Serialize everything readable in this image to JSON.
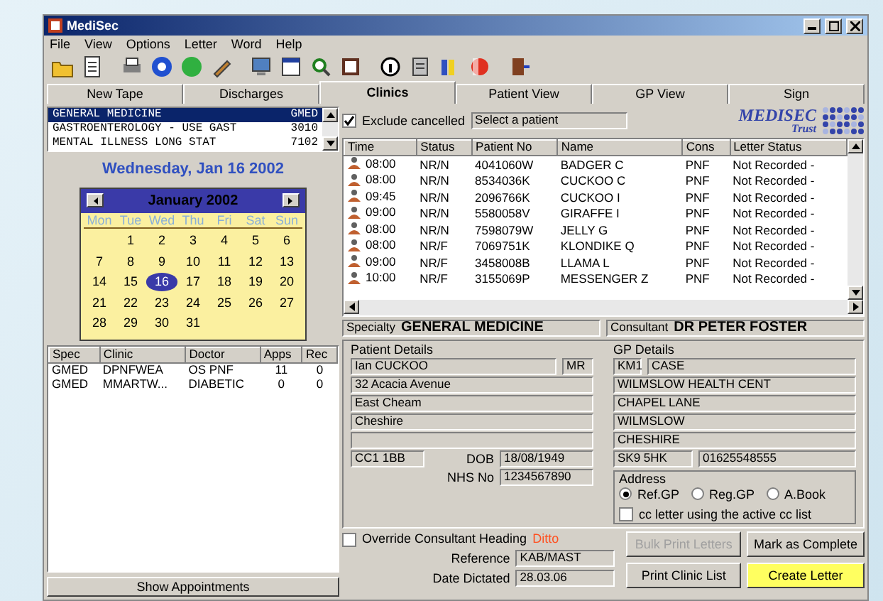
{
  "window": {
    "title": "MediSec"
  },
  "menu": [
    "File",
    "View",
    "Options",
    "Letter",
    "Word",
    "Help"
  ],
  "tabs": [
    {
      "label": "New Tape",
      "selected": false
    },
    {
      "label": "Discharges",
      "selected": false
    },
    {
      "label": "Clinics",
      "selected": true
    },
    {
      "label": "Patient View",
      "selected": false
    },
    {
      "label": "GP View",
      "selected": false
    },
    {
      "label": "Sign",
      "selected": false
    }
  ],
  "specialties": [
    {
      "name": "GENERAL MEDICINE",
      "code": "GMED",
      "selected": true
    },
    {
      "name": "GASTROENTEROLOGY - USE GAST",
      "code": "3010",
      "selected": false
    },
    {
      "name": "MENTAL ILLNESS LONG STAT",
      "code": "7102",
      "selected": false
    }
  ],
  "date_header": "Wednesday, Jan 16 2002",
  "calendar": {
    "month": "January 2002",
    "weekdays": [
      "Mon",
      "Tue",
      "Wed",
      "Thu",
      "Fri",
      "Sat",
      "Sun"
    ],
    "weeks": [
      [
        {
          "day": "1",
          "selected": false
        },
        {
          "day": "2",
          "selected": false
        },
        {
          "day": "3",
          "selected": false
        },
        {
          "day": "4",
          "selected": false
        },
        {
          "day": "5",
          "selected": false
        },
        {
          "day": "6",
          "selected": false
        }
      ],
      [
        {
          "day": "7",
          "selected": false
        },
        {
          "day": "8",
          "selected": false
        },
        {
          "day": "9",
          "selected": false
        },
        {
          "day": "10",
          "selected": false
        },
        {
          "day": "11",
          "selected": false
        },
        {
          "day": "12",
          "selected": false
        },
        {
          "day": "13",
          "selected": false
        }
      ],
      [
        {
          "day": "14",
          "selected": false
        },
        {
          "day": "15",
          "selected": false
        },
        {
          "day": "16",
          "selected": true
        },
        {
          "day": "17",
          "selected": false
        },
        {
          "day": "18",
          "selected": false
        },
        {
          "day": "19",
          "selected": false
        },
        {
          "day": "20",
          "selected": false
        }
      ],
      [
        {
          "day": "21",
          "selected": false
        },
        {
          "day": "22",
          "selected": false
        },
        {
          "day": "23",
          "selected": false
        },
        {
          "day": "24",
          "selected": false
        },
        {
          "day": "25",
          "selected": false
        },
        {
          "day": "26",
          "selected": false
        },
        {
          "day": "27",
          "selected": false
        }
      ],
      [
        {
          "day": "28",
          "selected": false
        },
        {
          "day": "29",
          "selected": false
        },
        {
          "day": "30",
          "selected": false
        },
        {
          "day": "31",
          "selected": false
        }
      ]
    ]
  },
  "clinics": {
    "columns": [
      "Spec",
      "Clinic",
      "Doctor",
      "Apps",
      "Rec"
    ],
    "rows": [
      [
        "GMED",
        "DPNFWEA",
        "OS PNF",
        "11",
        "0"
      ],
      [
        "GMED",
        "MMARTW...",
        "DIABETIC",
        "0",
        "0"
      ]
    ]
  },
  "show_appointments": "Show Appointments",
  "exclude_cancelled": {
    "label": "Exclude cancelled",
    "checked": true
  },
  "patient_select": {
    "value": "Select a patient"
  },
  "logo": {
    "name": "MEDISEC",
    "subtitle": "Trust"
  },
  "appointments": {
    "columns": [
      "Time",
      "Status",
      "Patient No",
      "Name",
      "Cons",
      "Letter Status"
    ],
    "rows": [
      [
        "08:00",
        "NR/N",
        "4041060W",
        "BADGER C",
        "PNF",
        "Not Recorded -"
      ],
      [
        "08:00",
        "NR/N",
        "8534036K",
        "CUCKOO C",
        "PNF",
        "Not Recorded -"
      ],
      [
        "09:45",
        "NR/N",
        "2096766K",
        "CUCKOO I",
        "PNF",
        "Not Recorded -"
      ],
      [
        "09:00",
        "NR/N",
        "5580058V",
        "GIRAFFE I",
        "PNF",
        "Not Recorded -"
      ],
      [
        "08:00",
        "NR/N",
        "7598079W",
        "JELLY G",
        "PNF",
        "Not Recorded -"
      ],
      [
        "08:00",
        "NR/F",
        "7069751K",
        "KLONDIKE Q",
        "PNF",
        "Not Recorded -"
      ],
      [
        "09:00",
        "NR/F",
        "3458008B",
        "LLAMA L",
        "PNF",
        "Not Recorded -"
      ],
      [
        "10:00",
        "NR/F",
        "3155069P",
        "MESSENGER Z",
        "PNF",
        "Not Recorded -"
      ]
    ]
  },
  "specialty": {
    "label": "Specialty",
    "value": "GENERAL MEDICINE"
  },
  "consultant": {
    "label": "Consultant",
    "value": "DR PETER FOSTER"
  },
  "patient_details": {
    "title": "Patient Details",
    "name": "Ian CUCKOO",
    "salutation": "MR",
    "address": [
      "32 Acacia Avenue",
      "East Cheam",
      "Cheshire"
    ],
    "postcode": "CC1 1BB",
    "dob_label": "DOB",
    "dob": "18/08/1949",
    "nhs_label": "NHS No",
    "nhs": "1234567890"
  },
  "gp_details": {
    "title": "GP Details",
    "code": "KM1",
    "name": "CASE",
    "address": [
      "WILMSLOW HEALTH CENT",
      "CHAPEL LANE",
      "WILMSLOW",
      "CHESHIRE"
    ],
    "postcode": "SK9 5HK",
    "phone": "01625548555"
  },
  "address": {
    "legend": "Address",
    "options": [
      {
        "label": "Ref.GP",
        "selected": true
      },
      {
        "label": "Reg.GP",
        "selected": false
      },
      {
        "label": "A.Book",
        "selected": false
      }
    ],
    "cc": {
      "label": "cc letter using the active cc list",
      "checked": false
    }
  },
  "override": {
    "label": "Override Consultant Heading",
    "checked": false,
    "note": "Ditto"
  },
  "reference": {
    "label": "Reference",
    "value": "KAB/MAST"
  },
  "date_dictated": {
    "label": "Date Dictated",
    "value": "28.03.06"
  },
  "buttons": [
    {
      "label": "Bulk Print Letters",
      "disabled": true,
      "highlighted": false
    },
    {
      "label": "Mark as Complete",
      "disabled": false,
      "highlighted": false
    },
    {
      "label": "Print Clinic List",
      "disabled": false,
      "highlighted": false
    },
    {
      "label": "Create Letter",
      "disabled": false,
      "highlighted": true
    }
  ]
}
